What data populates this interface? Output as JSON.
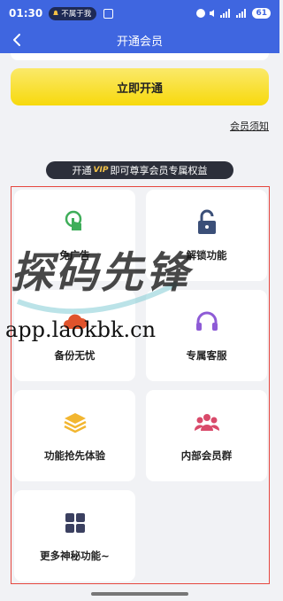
{
  "status_bar": {
    "time": "01:30",
    "notification_pill": "不属于我",
    "battery": "61"
  },
  "header": {
    "title": "开通会员"
  },
  "actions": {
    "open_button": "立即开通",
    "notice_link": "会员须知"
  },
  "banner": {
    "prefix": "开通",
    "vip": "VIP",
    "suffix": "即可尊享会员专属权益"
  },
  "benefits": [
    {
      "label": "免广告",
      "icon": "tap-finger-icon",
      "color": "#3fae5a"
    },
    {
      "label": "解锁功能",
      "icon": "unlock-icon",
      "color": "#3b4f78"
    },
    {
      "label": "备份无忧",
      "icon": "cloud-icon",
      "color": "#e0532c"
    },
    {
      "label": "专属客服",
      "icon": "headset-icon",
      "color": "#8e5bd6"
    },
    {
      "label": "功能抢先体验",
      "icon": "layers-icon",
      "color": "#f2b630"
    },
    {
      "label": "内部会员群",
      "icon": "group-icon",
      "color": "#d94a6a"
    },
    {
      "label": "更多神秘功能~",
      "icon": "grid-icon",
      "color": "#3b4060"
    }
  ],
  "watermark": {
    "text": "探码先锋",
    "url": "app.laokbk.cn"
  }
}
